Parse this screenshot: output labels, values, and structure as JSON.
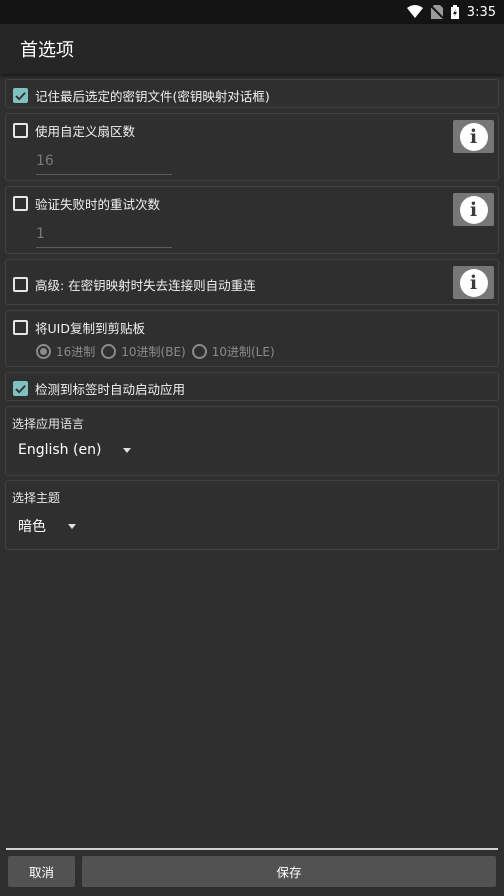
{
  "status_bar": {
    "time": "3:35",
    "icons": [
      "wifi-icon",
      "no-sim-icon",
      "battery-charging-icon"
    ]
  },
  "app_bar": {
    "title": "首选项"
  },
  "remember_key": {
    "label": "记住最后选定的密钥文件(密钥映射对话框)",
    "checked": true
  },
  "custom_sectors": {
    "label": "使用自定义扇区数",
    "checked": false,
    "value": "16"
  },
  "retry": {
    "label": "验证失败时的重试次数",
    "checked": false,
    "value": "1"
  },
  "auto_reconnect": {
    "label": "高级: 在密钥映射时失去连接则自动重连",
    "checked": false
  },
  "copy_uid": {
    "label": "将UID复制到剪贴板",
    "checked": false,
    "options": [
      {
        "label": "16进制",
        "selected": true
      },
      {
        "label": "10进制(BE)",
        "selected": false
      },
      {
        "label": "10进制(LE)",
        "selected": false
      }
    ]
  },
  "auto_start": {
    "label": "检测到标签时自动启动应用",
    "checked": true
  },
  "language": {
    "label": "选择应用语言",
    "value": "English (en)"
  },
  "theme": {
    "label": "选择主题",
    "value": "暗色"
  },
  "buttons": {
    "cancel": "取消",
    "save": "保存"
  },
  "colors": {
    "checkbox_accent": "#7fc1c1",
    "background": "#2f2f2f",
    "app_bar": "#262626",
    "button": "#525252"
  }
}
